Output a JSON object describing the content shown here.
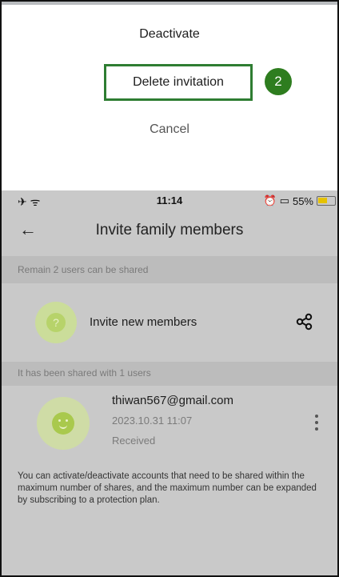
{
  "action_sheet": {
    "deactivate_label": "Deactivate",
    "delete_invitation_label": "Delete invitation",
    "step_badge": "2",
    "cancel_label": "Cancel",
    "highlight_color": "#2e7d32"
  },
  "status_bar": {
    "time": "11:14",
    "battery_percent": "55%"
  },
  "header": {
    "back_icon": "arrow-left-icon",
    "title": "Invite family members"
  },
  "remaining": {
    "label": "Remain 2 users can be shared"
  },
  "invite": {
    "label": "Invite new members",
    "icon": "share-icon"
  },
  "shared": {
    "label": "It has been shared with 1 users",
    "members": [
      {
        "email": "thiwan567@gmail.com",
        "date": "2023.10.31 11:07",
        "status": "Received"
      }
    ]
  },
  "footer_note": "You can activate/deactivate accounts that need to be shared within the maximum number of shares, and the maximum number can be expanded by subscribing to a protection plan."
}
